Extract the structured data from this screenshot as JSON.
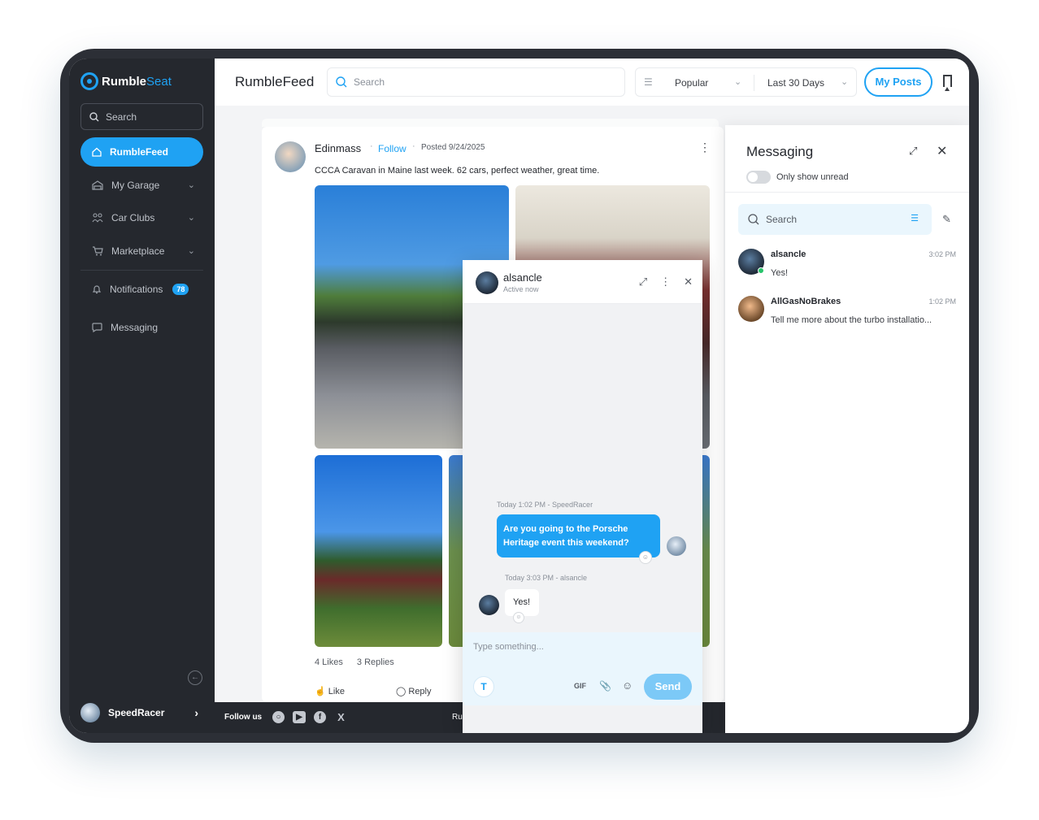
{
  "app": {
    "logo_rumble": "Rumble",
    "logo_seat": "Seat",
    "page_title": "RumbleFeed"
  },
  "sidebar": {
    "search_placeholder": "Search",
    "items": [
      {
        "label": "RumbleFeed",
        "icon": "home-icon",
        "active": true
      },
      {
        "label": "My Garage",
        "icon": "garage-icon",
        "has_submenu": true
      },
      {
        "label": "Car Clubs",
        "icon": "people-icon",
        "has_submenu": true
      },
      {
        "label": "Marketplace",
        "icon": "cart-icon",
        "has_submenu": true
      },
      {
        "label": "Notifications",
        "icon": "bell-icon",
        "badge": "78"
      },
      {
        "label": "Messaging",
        "icon": "chat-icon"
      }
    ],
    "user": {
      "name": "SpeedRacer"
    }
  },
  "topbar": {
    "search_placeholder": "Search",
    "sort": "Popular",
    "range": "Last 30 Days",
    "my_posts": "My Posts"
  },
  "footer": {
    "follow_label": "Follow us",
    "socials": [
      "instagram-icon",
      "youtube-icon",
      "facebook-icon",
      "x-icon"
    ],
    "truncated_text": "Ru"
  },
  "post": {
    "author": "Edinmass",
    "follow": "Follow",
    "posted": "Posted 9/24/2025",
    "text": "CCCA Caravan in Maine last week. 62 cars, perfect weather, great time.",
    "likes": "4 Likes",
    "replies": "3 Replies",
    "like_action": "Like",
    "reply_action": "Reply"
  },
  "chat": {
    "name": "alsancle",
    "status": "Active now",
    "messages": [
      {
        "meta": "Today 1:02 PM - SpeedRacer",
        "text": "Are you going to the Porsche Heritage event this weekend?",
        "direction": "out"
      },
      {
        "meta": "Today 3:03 PM - alsancle",
        "text": "Yes!",
        "direction": "in"
      }
    ],
    "composer_placeholder": "Type something...",
    "gif": "GIF",
    "send": "Send"
  },
  "messaging": {
    "title": "Messaging",
    "toggle_label": "Only show unread",
    "search_placeholder": "Search",
    "conversations": [
      {
        "name": "alsancle",
        "time": "3:02 PM",
        "preview": "Yes!",
        "online": true
      },
      {
        "name": "AllGasNoBrakes",
        "time": "1:02 PM",
        "preview": "Tell me more about the turbo installatio...",
        "online": false
      }
    ]
  },
  "colors": {
    "accent": "#1fa2f3",
    "sidebar_bg": "#25282e",
    "online": "#27c46b"
  }
}
